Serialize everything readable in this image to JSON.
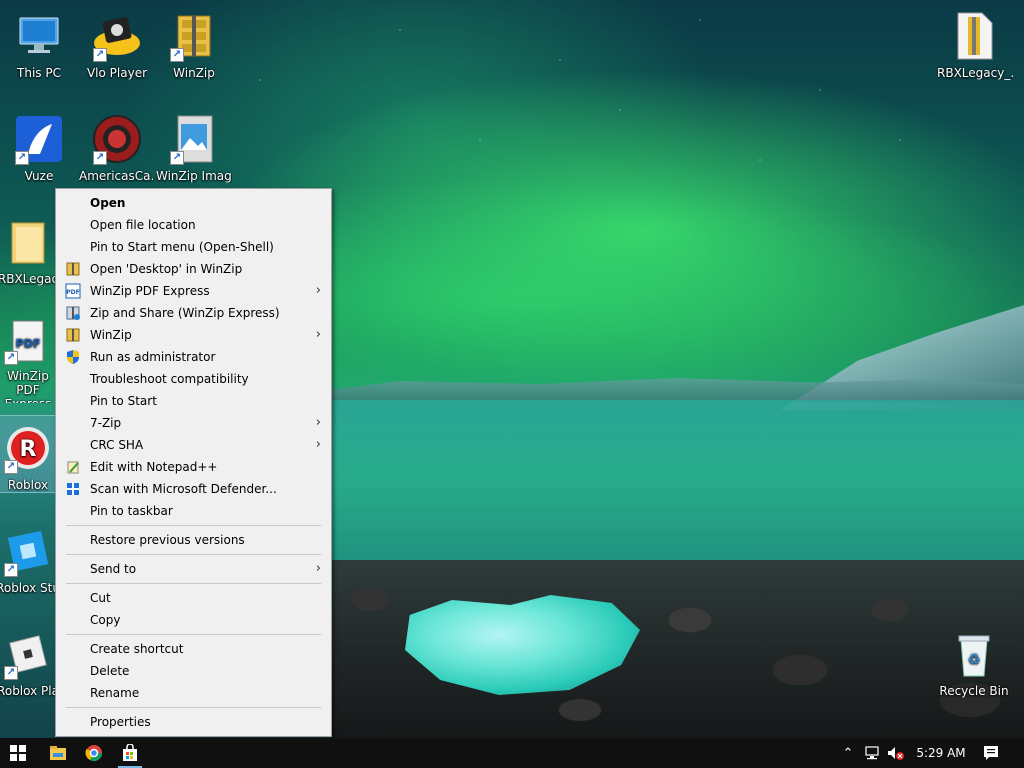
{
  "desktop": {
    "icons": [
      {
        "label": "This PC",
        "icon": "computer-icon",
        "shortcut": false
      },
      {
        "label": "Vlo Player",
        "icon": "media-player-icon",
        "shortcut": true
      },
      {
        "label": "WinZip",
        "icon": "winzip-icon",
        "shortcut": true
      },
      {
        "label": "RBXLegacy_...",
        "icon": "zip-file-icon",
        "shortcut": false
      },
      {
        "label": "Vuze",
        "icon": "vuze-frog-icon",
        "shortcut": true
      },
      {
        "label": "AmericasCa...",
        "icon": "casino-chip-icon",
        "shortcut": true
      },
      {
        "label": "WinZip Image M...",
        "icon": "winzip-image-icon",
        "shortcut": true
      },
      {
        "label": "RBXLegac",
        "icon": "folder-icon",
        "shortcut": false
      },
      {
        "label": "WinZip PDF Express",
        "icon": "pdf-icon",
        "shortcut": true
      },
      {
        "label": "Roblox",
        "icon": "roblox-icon",
        "shortcut": true,
        "selected": true
      },
      {
        "label": "Roblox Stu",
        "icon": "roblox-studio-icon",
        "shortcut": true
      },
      {
        "label": "Roblox Pla",
        "icon": "roblox-player-icon",
        "shortcut": true
      },
      {
        "label": "Recycle Bin",
        "icon": "recycle-bin-icon",
        "shortcut": false
      }
    ]
  },
  "context_menu": {
    "items": [
      {
        "label": "Open",
        "bold": true
      },
      {
        "label": "Open file location"
      },
      {
        "label": "Pin to Start menu (Open-Shell)"
      },
      {
        "label": "Open 'Desktop' in WinZip",
        "icon": "winzip-small-icon"
      },
      {
        "label": "WinZip PDF Express",
        "icon": "pdf-small-icon",
        "submenu": true
      },
      {
        "label": "Zip and Share (WinZip Express)",
        "icon": "zip-share-icon"
      },
      {
        "label": "WinZip",
        "icon": "winzip-small-icon",
        "submenu": true
      },
      {
        "label": "Run as administrator",
        "icon": "uac-shield-icon"
      },
      {
        "label": "Troubleshoot compatibility"
      },
      {
        "label": "Pin to Start"
      },
      {
        "label": "7-Zip",
        "submenu": true
      },
      {
        "label": "CRC SHA",
        "submenu": true
      },
      {
        "label": "Edit with Notepad++",
        "icon": "notepadpp-icon"
      },
      {
        "label": "Scan with Microsoft Defender...",
        "icon": "defender-icon"
      },
      {
        "label": "Pin to taskbar"
      },
      {
        "label": "Restore previous versions"
      },
      {
        "label": "Send to",
        "submenu": true
      },
      {
        "label": "Cut"
      },
      {
        "label": "Copy"
      },
      {
        "label": "Create shortcut"
      },
      {
        "label": "Delete"
      },
      {
        "label": "Rename"
      },
      {
        "label": "Properties"
      }
    ]
  },
  "taskbar": {
    "clock": "5:29 AM",
    "accent_color": "#7ab8e8"
  }
}
